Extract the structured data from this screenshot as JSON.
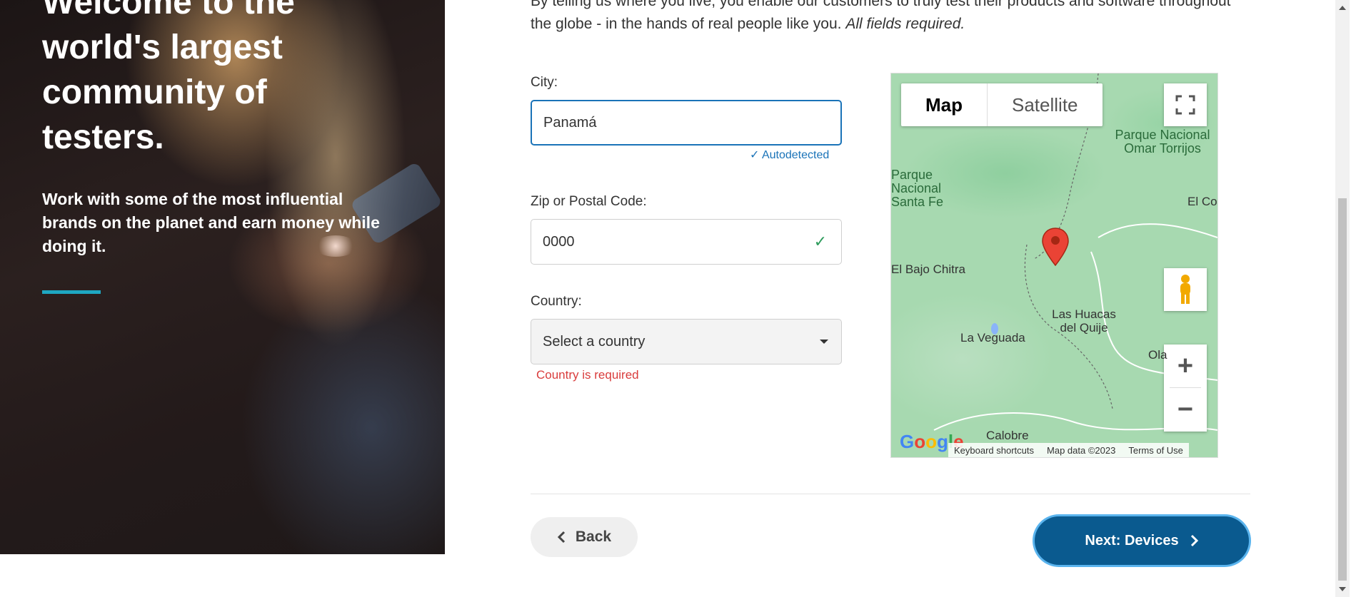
{
  "hero": {
    "title": "Welcome to the world's largest community of testers.",
    "subtitle": "Work with some of the most influential brands on the planet and earn money while doing it.",
    "accent_color": "#1ea7c2"
  },
  "intro": {
    "text": "By telling us where you live, you enable our customers to truly test their products and software throughout the globe - in the hands of real people like you.",
    "required_note": "All fields required."
  },
  "form": {
    "city_label": "City:",
    "city_value": "Panamá",
    "autodetected": "Autodetected",
    "zip_label": "Zip or Postal Code:",
    "zip_value": "0000",
    "country_label": "Country:",
    "country_placeholder": "Select a country",
    "country_error": "Country is required"
  },
  "map": {
    "map_label": "Map",
    "satellite_label": "Satellite",
    "places": {
      "parque_omar": "Parque Nacional Omar Torrijos",
      "parque_santa_fe": "Parque Nacional Santa Fe",
      "el_co": "El Co",
      "el_bajo_chitra": "El Bajo Chitra",
      "las_huacas": "Las Huacas del Quije",
      "la_veguada": "La Veguada",
      "ola": "Ola",
      "calobre": "Calobre"
    },
    "footer": {
      "shortcuts": "Keyboard shortcuts",
      "data": "Map data ©2023",
      "terms": "Terms of Use"
    },
    "logo": "Google"
  },
  "nav": {
    "back_label": "Back",
    "next_label": "Next: Devices",
    "next_color": "#0a5a8f"
  },
  "icons": {
    "autodetected": "check-icon",
    "zip_valid": "check-icon",
    "select_caret": "caret-down-icon",
    "fullscreen": "fullscreen-icon",
    "pegman": "pegman-icon",
    "zoom_in": "plus-icon",
    "zoom_out": "minus-icon",
    "pin": "map-pin-icon",
    "back": "chevron-left-icon",
    "next": "chevron-right-icon"
  }
}
